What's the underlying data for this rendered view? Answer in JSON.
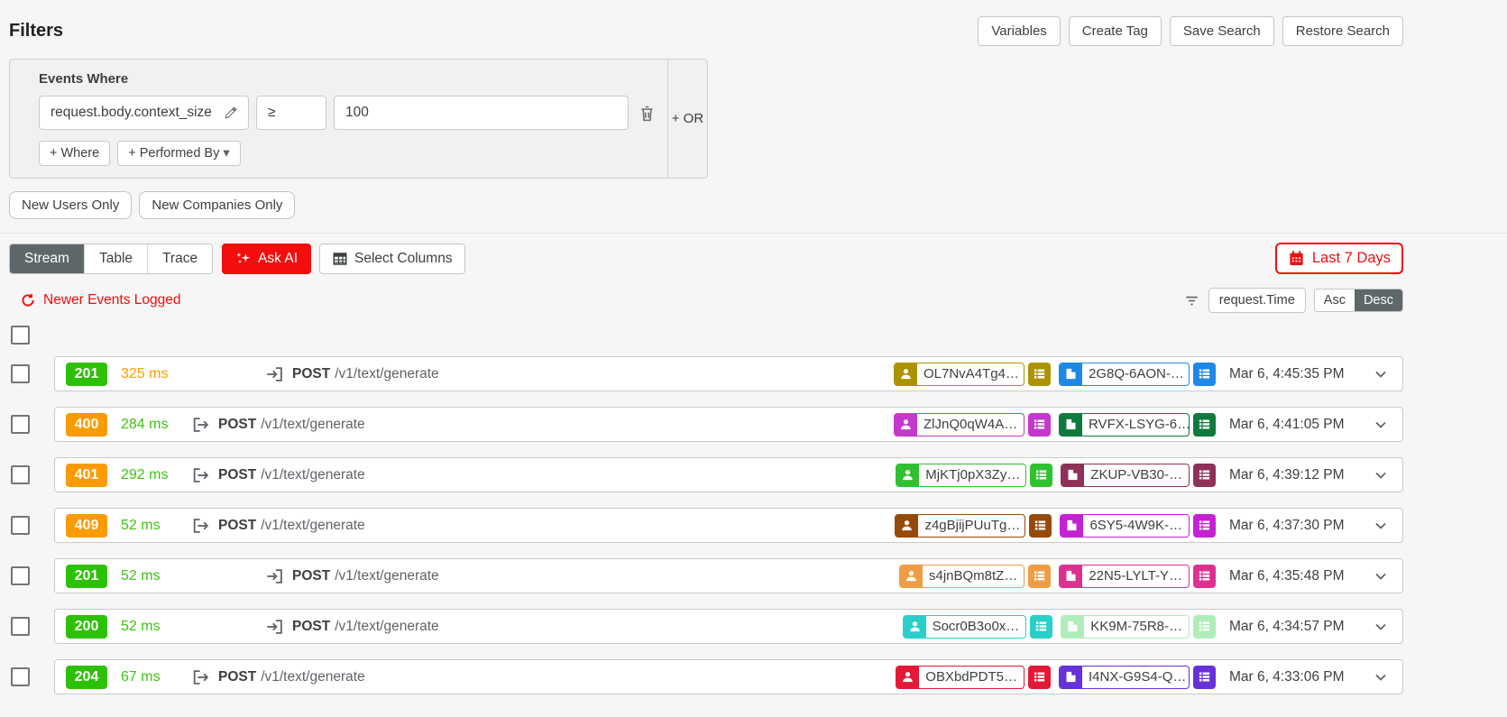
{
  "colors": {
    "accent_red": "#f40d0d",
    "status_green": "#2dc106",
    "status_orange": "#fb9b00",
    "latency_green": "#3fc312",
    "latency_orange": "#fb9b00",
    "tab_active_bg": "#5e676a"
  },
  "icons": {
    "caret_down": "▾"
  },
  "header": {
    "title": "Filters",
    "actions": [
      "Variables",
      "Create Tag",
      "Save Search",
      "Restore Search"
    ]
  },
  "filter_panel": {
    "title": "Events Where",
    "field": "request.body.context_size",
    "operator": "≥",
    "value": "100",
    "or_label": "+ OR",
    "where_label": "+ Where",
    "performed_by_label": "+ Performed By"
  },
  "quick_filters": {
    "new_users": "New Users Only",
    "new_companies": "New Companies Only"
  },
  "toolbar": {
    "tabs": [
      {
        "label": "Stream",
        "active": true
      },
      {
        "label": "Table",
        "active": false
      },
      {
        "label": "Trace",
        "active": false
      }
    ],
    "ask_ai_label": "Ask AI",
    "select_columns_label": "Select Columns",
    "date_range_label": "Last 7 Days"
  },
  "stream_bar": {
    "refresh_label": "Newer Events Logged",
    "sort_field": "request.Time",
    "asc_label": "Asc",
    "desc_label": "Desc",
    "active_order": "Desc"
  },
  "rows": [
    {
      "status": "201",
      "status_color": "#2dc106",
      "latency": "325 ms",
      "latency_color": "#fb9b00",
      "direction": "in",
      "method": "POST",
      "path": "/v1/text/generate",
      "user_id": "OL7NvA4Tg4…",
      "user_color": "#ad9200",
      "company_id": "2G8Q-6AON-…",
      "company_color": "#1e88e5",
      "time": "Mar 6, 4:45:35 PM"
    },
    {
      "status": "400",
      "status_color": "#fb9b00",
      "latency": "284 ms",
      "latency_color": "#3fc312",
      "direction": "out",
      "method": "POST",
      "path": "/v1/text/generate",
      "user_id": "ZlJnQ0qW4A…",
      "user_color": "#c438cc",
      "company_id": "RVFX-LSYG-6…",
      "company_color": "#0e7a3d",
      "time": "Mar 6, 4:41:05 PM"
    },
    {
      "status": "401",
      "status_color": "#fb9b00",
      "latency": "292 ms",
      "latency_color": "#3fc312",
      "direction": "out",
      "method": "POST",
      "path": "/v1/text/generate",
      "user_id": "MjKTj0pX3Zy…",
      "user_color": "#2fc12f",
      "company_id": "ZKUP-VB30-…",
      "company_color": "#8e3158",
      "time": "Mar 6, 4:39:12 PM"
    },
    {
      "status": "409",
      "status_color": "#fb9b00",
      "latency": "52 ms",
      "latency_color": "#3fc312",
      "direction": "out",
      "method": "POST",
      "path": "/v1/text/generate",
      "user_id": "z4gBjijPUuTg…",
      "user_color": "#964a0a",
      "company_id": "6SY5-4W9K-…",
      "company_color": "#c421d4",
      "time": "Mar 6, 4:37:30 PM"
    },
    {
      "status": "201",
      "status_color": "#2dc106",
      "latency": "52 ms",
      "latency_color": "#3fc312",
      "direction": "in",
      "method": "POST",
      "path": "/v1/text/generate",
      "user_id": "s4jnBQm8tZ…",
      "user_color": "#ef9d45",
      "company_id": "22N5-LYLT-Y…",
      "company_color": "#dd3190",
      "time": "Mar 6, 4:35:48 PM"
    },
    {
      "status": "200",
      "status_color": "#2dc106",
      "latency": "52 ms",
      "latency_color": "#3fc312",
      "direction": "in",
      "method": "POST",
      "path": "/v1/text/generate",
      "user_id": "Socr0B3o0x…",
      "user_color": "#2bcfc9",
      "company_id": "KK9M-75R8-…",
      "company_color": "#b0edbb",
      "time": "Mar 6, 4:34:57 PM"
    },
    {
      "status": "204",
      "status_color": "#2dc106",
      "latency": "67 ms",
      "latency_color": "#3fc312",
      "direction": "out",
      "method": "POST",
      "path": "/v1/text/generate",
      "user_id": "OBXbdPDT5…",
      "user_color": "#e31837",
      "company_id": "I4NX-G9S4-Q…",
      "company_color": "#6631d8",
      "time": "Mar 6, 4:33:06 PM"
    }
  ]
}
